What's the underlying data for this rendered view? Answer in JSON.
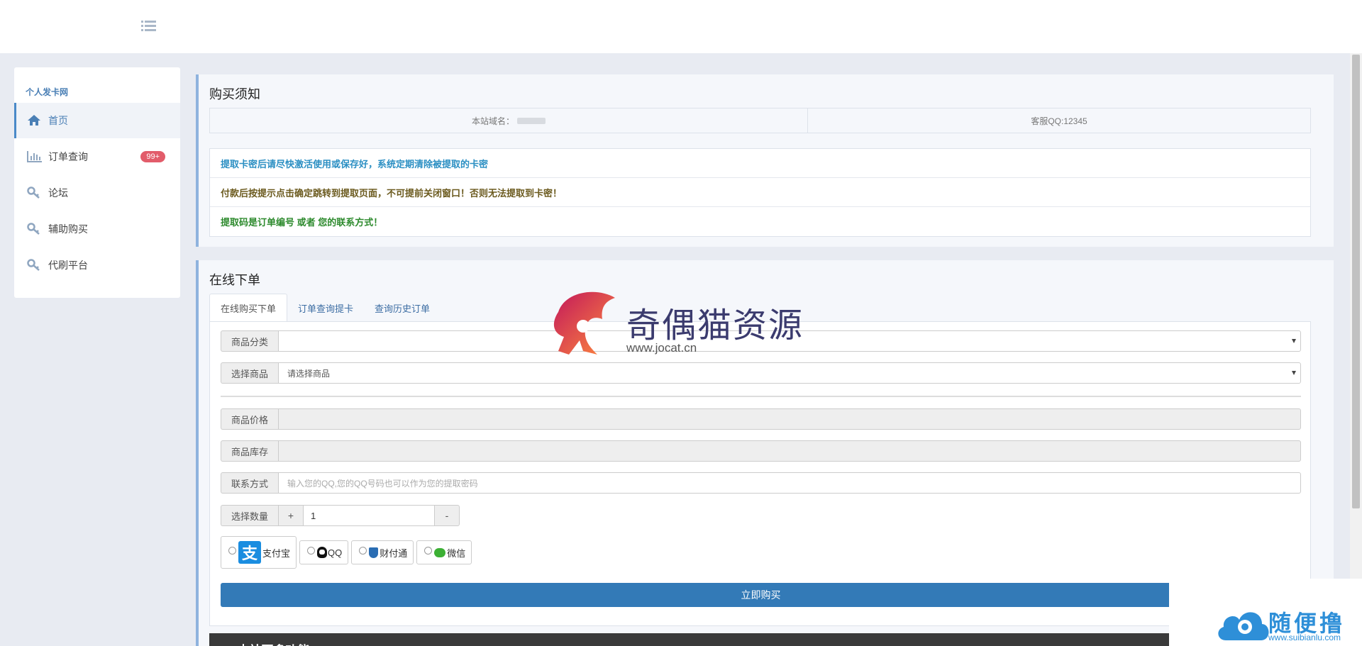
{
  "sidebar": {
    "site_name": "个人发卡网",
    "items": [
      {
        "label": "首页",
        "icon": "home-icon"
      },
      {
        "label": "订单查询",
        "icon": "bar-chart-icon",
        "badge": "99+"
      },
      {
        "label": "论坛",
        "icon": "key-icon"
      },
      {
        "label": "辅助购买",
        "icon": "key-icon"
      },
      {
        "label": "代刷平台",
        "icon": "key-icon"
      }
    ]
  },
  "notice_panel": {
    "title": "购买须知",
    "domain_label": "本站域名：",
    "service_qq": "客服QQ:12345",
    "notices": [
      "提取卡密后请尽快激活使用或保存好，系统定期清除被提取的卡密",
      "付款后按提示点击确定跳转到提取页面，不可提前关闭窗口！否则无法提取到卡密！",
      "提取码是订单编号 或者 您的联系方式！"
    ]
  },
  "order_panel": {
    "title": "在线下单",
    "tabs": [
      "在线购买下单",
      "订单查询提卡",
      "查询历史订单"
    ],
    "fields": {
      "category_label": "商品分类",
      "category_value": "",
      "product_label": "选择商品",
      "product_value": "请选择商品",
      "price_label": "商品价格",
      "stock_label": "商品库存",
      "contact_label": "联系方式",
      "contact_placeholder": "输入您的QQ,您的QQ号码也可以作为您的提取密码",
      "quantity_label": "选择数量",
      "quantity_plus": "+",
      "quantity_value": "1",
      "quantity_minus": "-"
    },
    "payments": [
      "支付宝",
      "QQ",
      "财付通",
      "微信"
    ],
    "alipay_glyph": "支",
    "buy_label": "立即购买",
    "more_title": "◎ 本站更多功能"
  },
  "watermarks": {
    "main_text": "奇偶猫资源",
    "main_url": "www.jocat.cn",
    "corner_text": "随便撸",
    "corner_url": "www.suibianlu.com"
  },
  "colors": {
    "accent": "#337ab7",
    "badge": "#e25c6a",
    "notice_blue": "#2b8fc3",
    "notice_brown": "#6b5a1e",
    "notice_green": "#2d8a2d"
  }
}
